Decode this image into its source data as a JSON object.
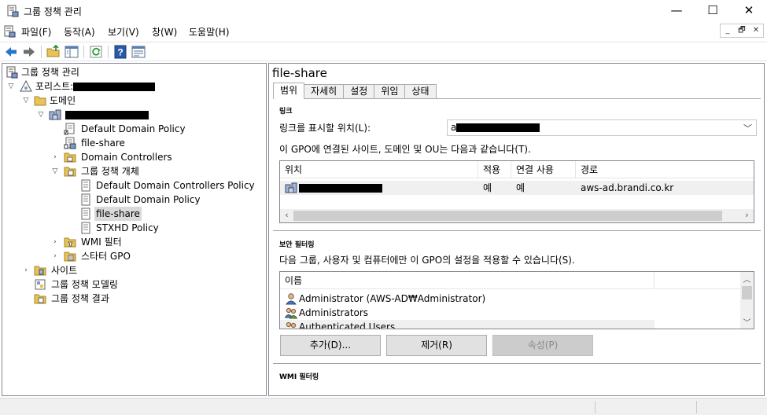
{
  "window": {
    "title": "그룹 정책 관리",
    "minimize": "—",
    "maximize": "☐",
    "close": "✕"
  },
  "menu": {
    "items": [
      "파일(F)",
      "동작(A)",
      "보기(V)",
      "창(W)",
      "도움말(H)"
    ],
    "mdi": [
      "_",
      "🗗",
      "✕"
    ]
  },
  "toolbar": {
    "icons": [
      "back-arrow-icon",
      "forward-arrow-icon",
      "up-folder-icon",
      "show-hide-tree-icon",
      "refresh-icon",
      "help-icon",
      "properties-icon"
    ]
  },
  "tree": {
    "root": "그룹 정책 관리",
    "forest_prefix": "포리스트:",
    "domains": "도메인",
    "default_domain_policy": "Default Domain Policy",
    "file_share_link": "file-share",
    "domain_controllers": "Domain Controllers",
    "gpo_container": "그룹 정책 개체",
    "gpo_items": [
      "Default Domain Controllers Policy",
      "Default Domain Policy",
      "file-share",
      "STXHD Policy"
    ],
    "wmi_filters": "WMI 필터",
    "starter_gpo": "스타터 GPO",
    "sites": "사이트",
    "modeling": "그룹 정책 모델링",
    "results": "그룹 정책 결과"
  },
  "details": {
    "title": "file-share",
    "tabs": [
      "범위",
      "자세히",
      "설정",
      "위임",
      "상태"
    ],
    "active_tab": "범위",
    "links": {
      "section": "링크",
      "location_label": "링크를 표시할 위치(L):",
      "location_value_prefix": "a",
      "description": "이 GPO에 연결된 사이트, 도메인 및 OU는 다음과 같습니다(T).",
      "columns": [
        "위치",
        "적용",
        "연결 사용",
        "경로"
      ],
      "rows": [
        {
          "enforced": "예",
          "link_enabled": "예",
          "path": "aws-ad.brandi.co.kr"
        }
      ]
    },
    "security": {
      "section": "보안 필터링",
      "description": "다음 그룹, 사용자 및 컴퓨터에만 이 GPO의 설정을 적용할 수 있습니다(S).",
      "columns": [
        "이름"
      ],
      "rows": [
        "Administrator (AWS-AD₩Administrator)",
        "Administrators",
        "Authenticated Users"
      ],
      "buttons": {
        "add": "추가(D)...",
        "remove": "제거(R)",
        "properties": "속성(P)"
      }
    },
    "wmi": {
      "section": "WMI 필터링"
    }
  },
  "colors": {
    "selection": "#d9d9d9",
    "border": "#828790",
    "button": "#e1e1e1"
  }
}
